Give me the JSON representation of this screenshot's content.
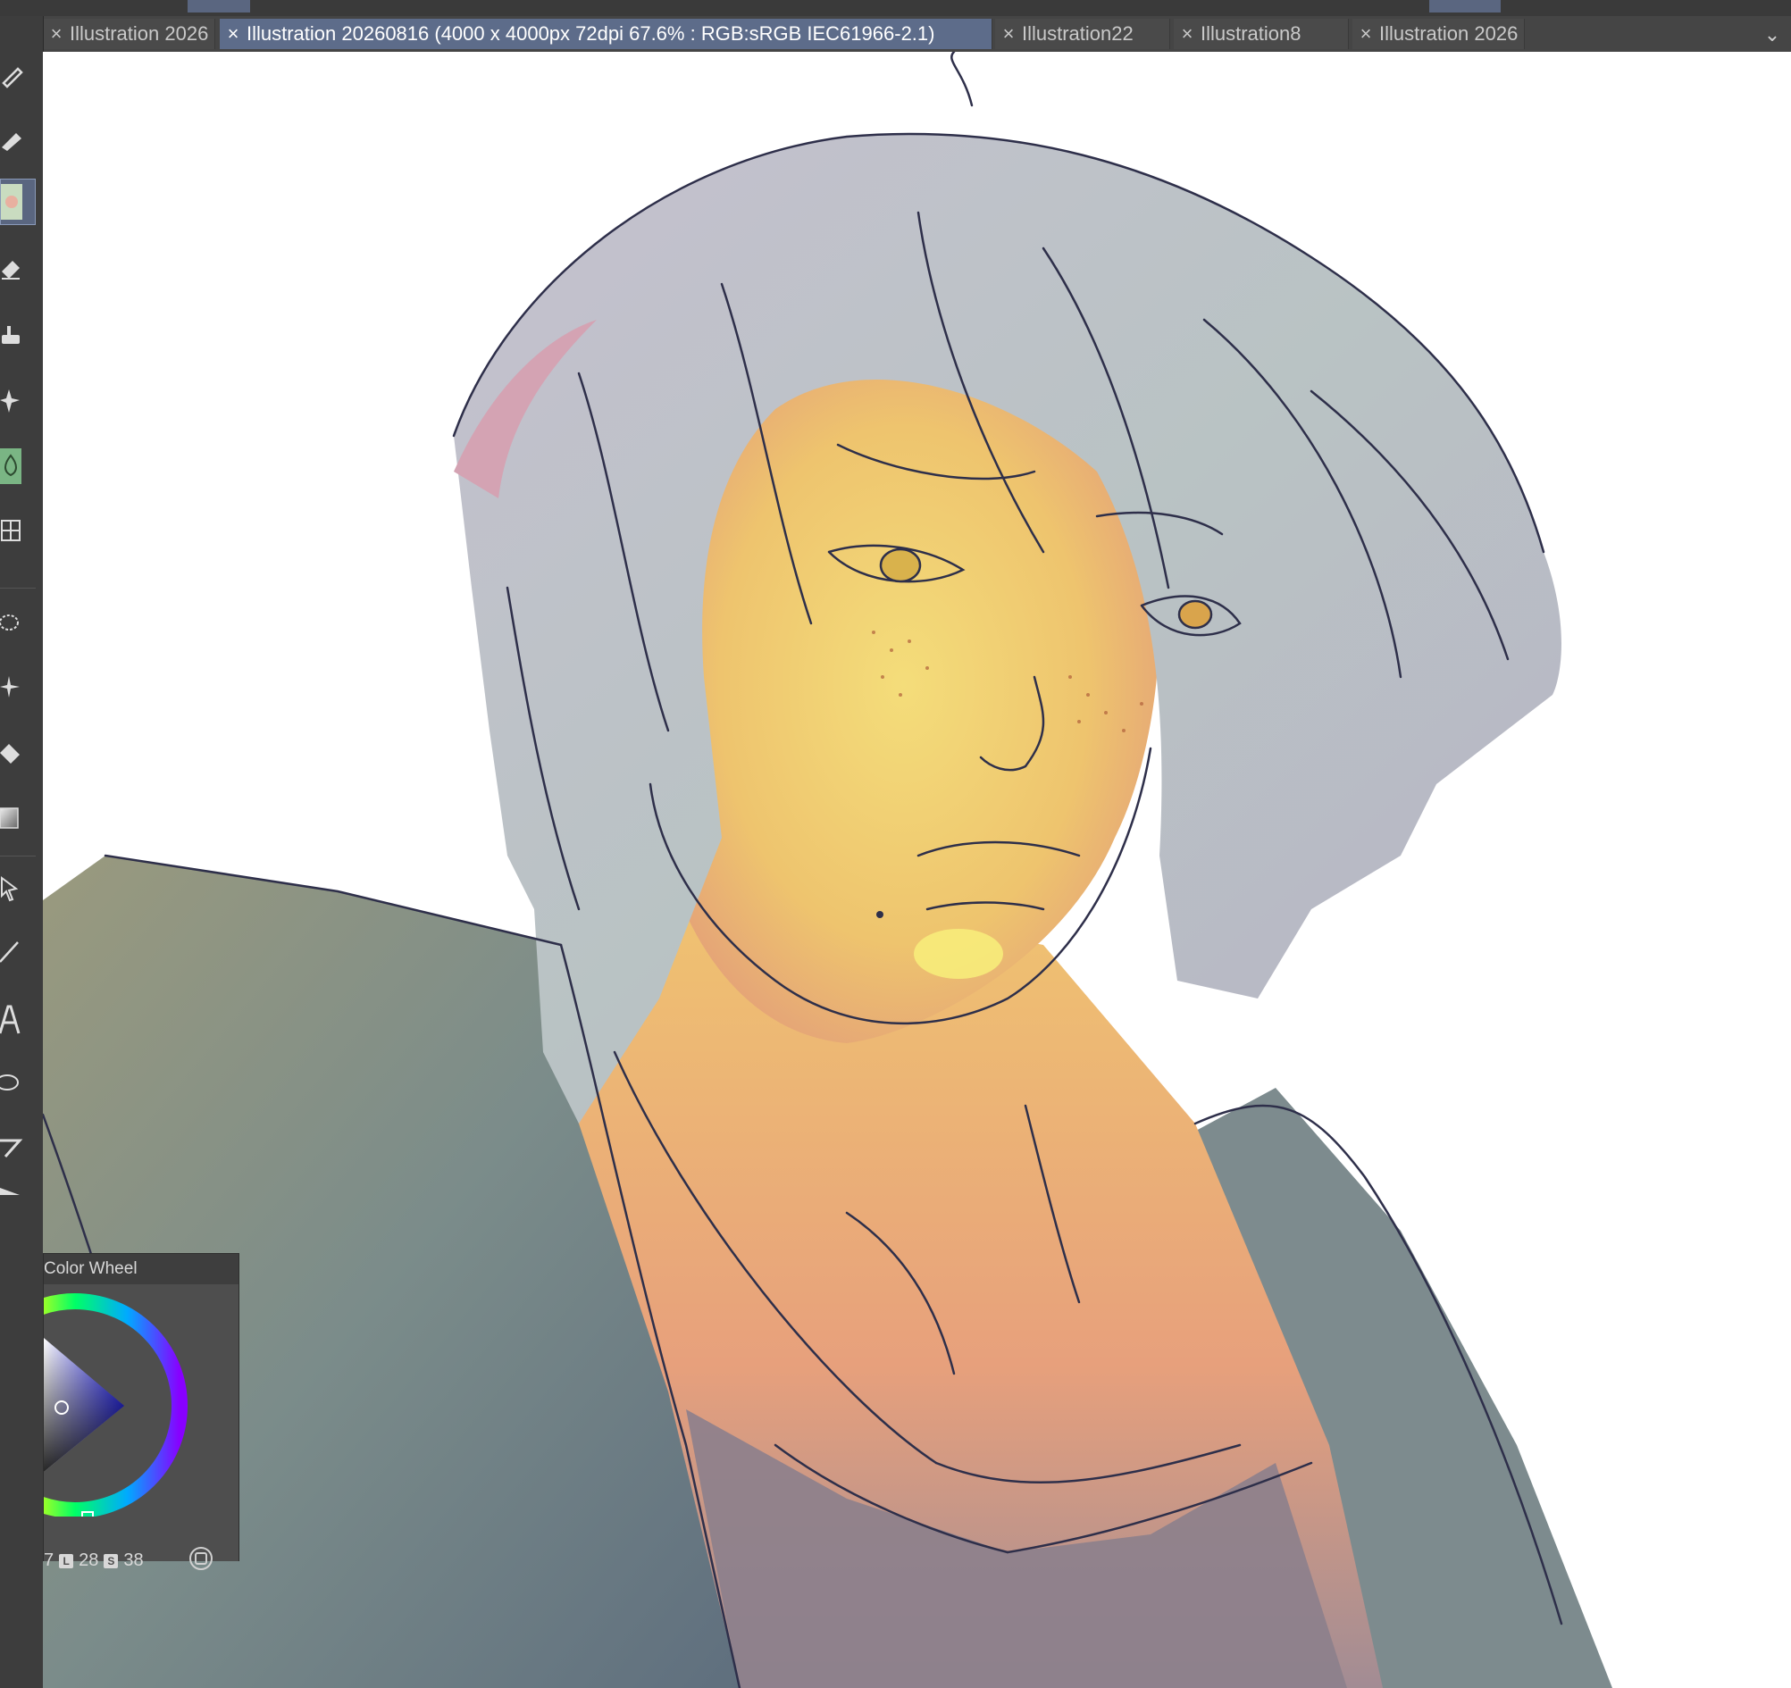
{
  "tabs": [
    {
      "label": "Illustration 2026",
      "active": false
    },
    {
      "label": "Illustration 20260816 (4000 x 4000px 72dpi 67.6% : RGB:sRGB IEC61966-2.1)",
      "active": true
    },
    {
      "label": "Illustration22",
      "active": false
    },
    {
      "label": "Illustration8",
      "active": false
    },
    {
      "label": "Illustration 2026",
      "active": false
    }
  ],
  "tab_close_glyph": "×",
  "tab_menu_glyph": "⌄",
  "tools": [
    {
      "name": "pen-tool",
      "icon": "pen-icon"
    },
    {
      "name": "pencil-tool",
      "icon": "pencil-icon"
    },
    {
      "name": "brush-tool",
      "icon": "brush-thumbnail-icon"
    },
    {
      "name": "eraser-tool",
      "icon": "eraser-icon"
    },
    {
      "name": "decoration-tool",
      "icon": "decoration-icon"
    },
    {
      "name": "effect-tool",
      "icon": "sparkle-icon"
    },
    {
      "name": "blend-tool",
      "icon": "blend-drop-icon"
    },
    {
      "name": "figure-tool",
      "icon": "figure-icon"
    },
    {
      "name": "lasso-tool",
      "icon": "lasso-icon"
    },
    {
      "name": "magic-wand-tool",
      "icon": "magic-wand-icon"
    },
    {
      "name": "fill-tool",
      "icon": "fill-bucket-icon"
    },
    {
      "name": "gradient-tool",
      "icon": "gradient-icon"
    },
    {
      "name": "operation-tool",
      "icon": "operation-icon"
    },
    {
      "name": "line-tool",
      "icon": "line-icon"
    },
    {
      "name": "text-tool",
      "icon": "text-icon"
    },
    {
      "name": "ellipse-tool",
      "icon": "ellipse-icon"
    },
    {
      "name": "ruler-tool",
      "icon": "ruler-icon"
    }
  ],
  "color_panel": {
    "title": "Color Wheel",
    "value_h": "7",
    "label_l": "L",
    "value_l": "28",
    "label_s": "S",
    "value_s": "38"
  },
  "colors": {
    "tab_active": "#5d6c8a",
    "toolbar_bg": "#3d3d3d",
    "hair": "#b8bfc9",
    "skin_light": "#f2d87a",
    "skin_warm": "#e8a97a",
    "shirt": "#7a8a88",
    "lineart": "#2e2f4a"
  }
}
